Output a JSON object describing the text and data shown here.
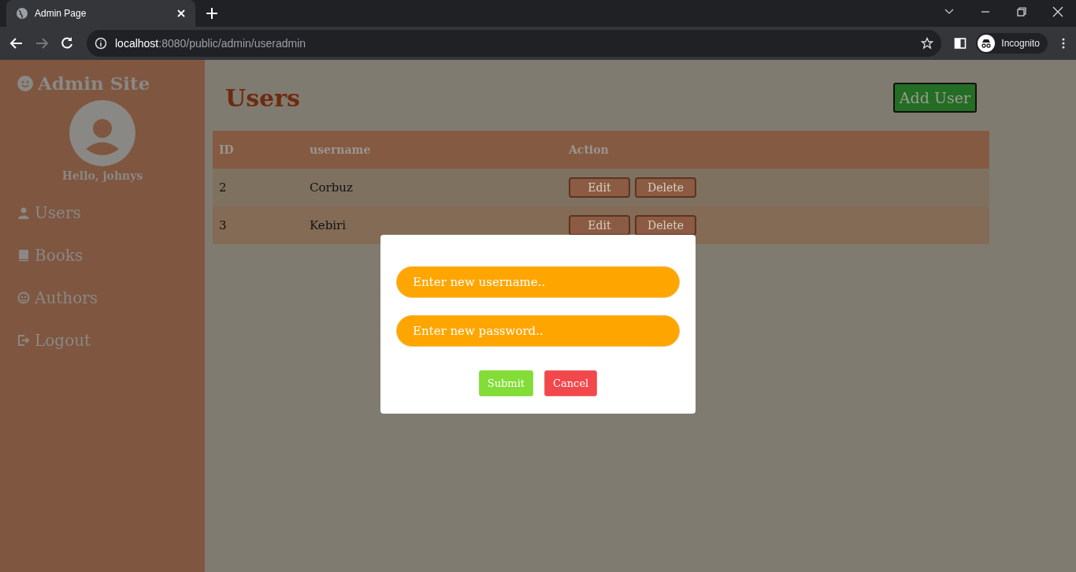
{
  "browser": {
    "tab_title": "Admin Page",
    "url_host": "localhost",
    "url_rest": ":8080/public/admin/useradmin",
    "profile": "Incognito"
  },
  "sidebar": {
    "site_title": "Admin Site",
    "greeting": "Hello, johnys",
    "items": [
      {
        "label": "Users",
        "kind": "user"
      },
      {
        "label": "Books",
        "kind": "book"
      },
      {
        "label": "Authors",
        "kind": "face"
      },
      {
        "label": "Logout",
        "kind": "logout"
      }
    ]
  },
  "page": {
    "title": "Users",
    "add_button": "Add User"
  },
  "table": {
    "columns": [
      "ID",
      "username",
      "Action"
    ],
    "rows": [
      {
        "id": "2",
        "username": "Corbuz",
        "actions": [
          "Edit",
          "Delete"
        ]
      },
      {
        "id": "3",
        "username": "Kebiri",
        "actions": [
          "Edit",
          "Delete"
        ]
      }
    ]
  },
  "dialog": {
    "fields": [
      {
        "placeholder": "Enter new username.."
      },
      {
        "placeholder": "Enter new password.."
      }
    ],
    "buttons": [
      {
        "label": "Submit",
        "kind": "submit"
      },
      {
        "label": "Cancel",
        "kind": "cancel"
      }
    ]
  }
}
